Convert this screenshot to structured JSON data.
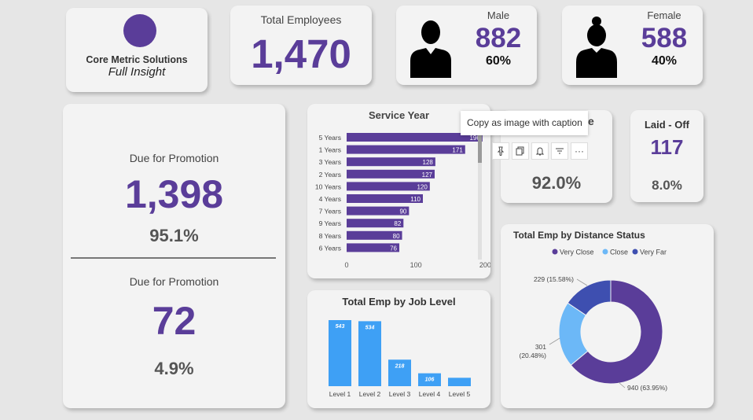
{
  "company": {
    "name": "Core Metric Solutions",
    "tagline": "Full Insight"
  },
  "total_employees": {
    "label": "Total Employees",
    "value": "1,470"
  },
  "male": {
    "label": "Male",
    "value": "882",
    "percent": "60%"
  },
  "female": {
    "label": "Female",
    "value": "588",
    "percent": "40%"
  },
  "promotion": [
    {
      "label": "Due for Promotion",
      "value": "1,398",
      "percent": "95.1%"
    },
    {
      "label": "Due for Promotion",
      "value": "72",
      "percent": "4.9%"
    }
  ],
  "retained": {
    "title_visible": "e",
    "value_visible": "",
    "percent": "92.0%"
  },
  "laid_off": {
    "label": "Laid - Off",
    "value": "117",
    "percent": "8.0%"
  },
  "tooltip": {
    "text": "Copy as image with caption"
  },
  "toolbar": {
    "icons": [
      "pin-icon",
      "copy-icon",
      "bell-icon",
      "filter-icon",
      "more-icon"
    ],
    "more_label": "···"
  },
  "colors": {
    "purple": "#5a3d99",
    "bar_blue": "#3ea0f5",
    "light_blue": "#6cb8f7",
    "indigo": "#3e4fb0"
  },
  "chart_data": [
    {
      "type": "bar",
      "orientation": "horizontal",
      "title": "Service Year",
      "categories": [
        "5 Years",
        "1 Years",
        "3 Years",
        "2 Years",
        "10 Years",
        "4 Years",
        "7 Years",
        "9 Years",
        "8 Years",
        "6 Years"
      ],
      "values": [
        196,
        171,
        128,
        127,
        120,
        110,
        90,
        82,
        80,
        76
      ],
      "xlim": [
        0,
        220
      ],
      "xticks": [
        "0",
        "100",
        "200"
      ],
      "color": "#5a3d99"
    },
    {
      "type": "bar",
      "title": "Total Emp by Job Level",
      "categories": [
        "Level 1",
        "Level 2",
        "Level 3",
        "Level 4",
        "Level 5"
      ],
      "values": [
        543,
        534,
        218,
        106,
        69
      ],
      "labels": [
        "543",
        "534",
        "218",
        "106",
        ""
      ],
      "ylim": [
        0,
        600
      ],
      "color": "#3ea0f5"
    },
    {
      "type": "pie",
      "donut": true,
      "title": "Total Emp by Distance Status",
      "legend": [
        "Very Close",
        "Close",
        "Very Far"
      ],
      "values": [
        940,
        301,
        229
      ],
      "colors": [
        "#5a3d99",
        "#6cb8f7",
        "#3e4fb0"
      ],
      "labels": [
        [
          "940 (63.95%)"
        ],
        [
          "301",
          "(20.48%)"
        ],
        [
          "229 (15.58%)"
        ]
      ],
      "legend_position": "top"
    }
  ]
}
